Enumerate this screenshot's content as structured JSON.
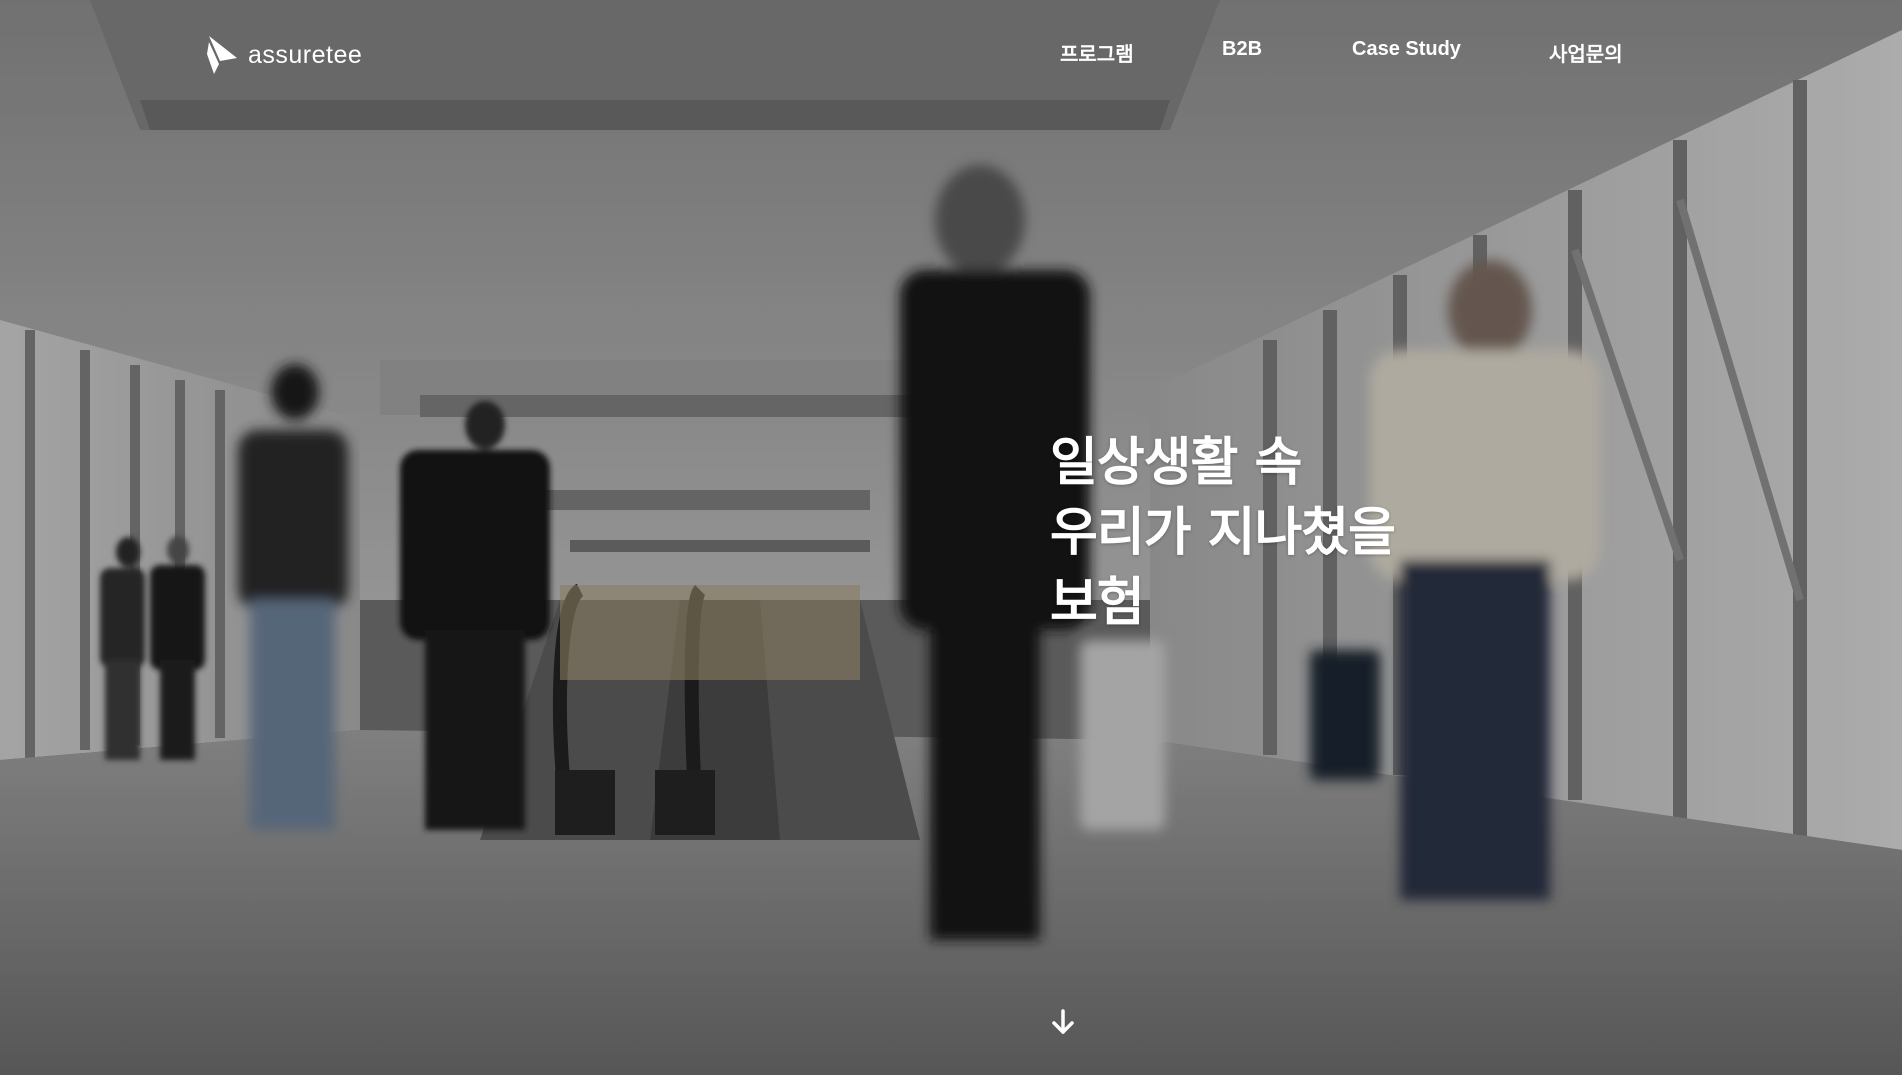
{
  "brand": {
    "name": "assuretee",
    "logo_icon": "sail-logo-icon"
  },
  "nav": {
    "items": [
      {
        "label": "프로그램"
      },
      {
        "label": "B2B"
      },
      {
        "label": "Case Study"
      },
      {
        "label": "사업문의"
      }
    ]
  },
  "hero": {
    "headline_lines": [
      "일상생활 속",
      "우리가 지나쳤을",
      "보험"
    ],
    "scroll_icon": "arrow-down-icon",
    "background": "airport-corridor-photo"
  },
  "colors": {
    "text": "#ffffff",
    "overlay": "#000000"
  }
}
